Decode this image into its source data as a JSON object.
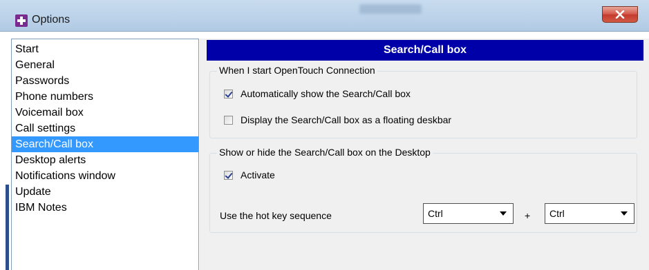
{
  "window": {
    "title": "Options",
    "close_label": "x"
  },
  "sidebar": {
    "items": [
      {
        "label": "Start",
        "selected": false
      },
      {
        "label": "General",
        "selected": false
      },
      {
        "label": "Passwords",
        "selected": false
      },
      {
        "label": "Phone numbers",
        "selected": false
      },
      {
        "label": "Voicemail box",
        "selected": false
      },
      {
        "label": "Call settings",
        "selected": false
      },
      {
        "label": "Search/Call box",
        "selected": true
      },
      {
        "label": "Desktop alerts",
        "selected": false
      },
      {
        "label": "Notifications window",
        "selected": false
      },
      {
        "label": "Update",
        "selected": false
      },
      {
        "label": "IBM Notes",
        "selected": false
      }
    ]
  },
  "main": {
    "header": "Search/Call box",
    "group1": {
      "legend": "When I start OpenTouch Connection",
      "auto_show": {
        "label": "Automatically show the Search/Call box",
        "checked": true
      },
      "floating": {
        "label": "Display the Search/Call box as a floating deskbar",
        "checked": false
      }
    },
    "group2": {
      "legend": "Show or hide the Search/Call box on the Desktop",
      "activate": {
        "label": "Activate",
        "checked": true
      },
      "hotkey_label": "Use the hot key sequence",
      "modifier1": "Ctrl",
      "plus": "+",
      "modifier2": "Ctrl"
    }
  },
  "colors": {
    "header_bg": "#0000a8",
    "selection": "#3399ff",
    "close_button": "#c43a2c",
    "app_icon": "#7a2b8f"
  }
}
